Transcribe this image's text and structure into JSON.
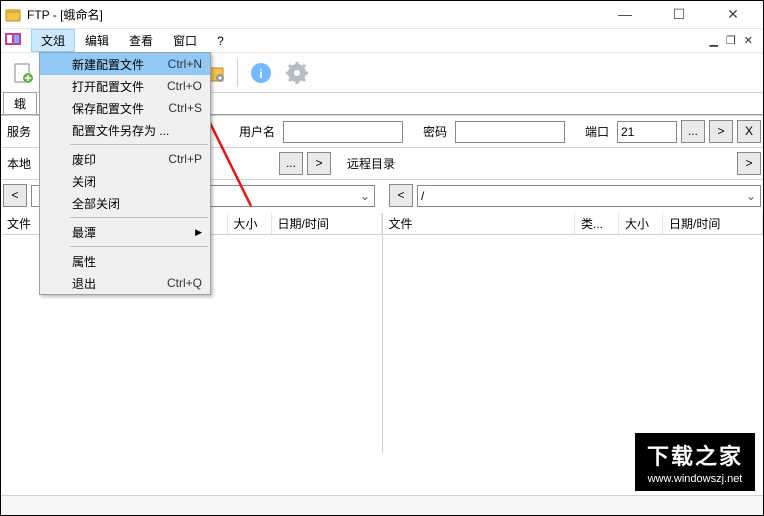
{
  "window": {
    "title": "FTP - [蛾命名]"
  },
  "menubar": {
    "file": "文俎",
    "edit": "编辑",
    "view": "查看",
    "window": "窗口",
    "help": "?"
  },
  "dropdown": {
    "new_profile": {
      "label": "新建配置文件",
      "shortcut": "Ctrl+N"
    },
    "open_profile": {
      "label": "打开配置文件",
      "shortcut": "Ctrl+O"
    },
    "save_profile": {
      "label": "保存配置文件",
      "shortcut": "Ctrl+S"
    },
    "save_as": {
      "label": "配置文件另存为 ..."
    },
    "abort": {
      "label": "废印",
      "shortcut": "Ctrl+P"
    },
    "close": {
      "label": "关闭"
    },
    "close_all": {
      "label": "全部关闭"
    },
    "recent": {
      "label": "最潭"
    },
    "properties": {
      "label": "属性"
    },
    "exit": {
      "label": "退出",
      "shortcut": "Ctrl+Q"
    }
  },
  "tab": {
    "label": "蛾"
  },
  "form": {
    "server_label": "服务",
    "user_label": "用户名",
    "pass_label": "密码",
    "port_label": "端口",
    "port_value": "21",
    "browse": "...",
    "arrow_r": ">",
    "x": "X",
    "local_label": "本地",
    "remote_label": "远程目录",
    "back": "<",
    "remote_path": "/"
  },
  "columns": {
    "file": "文件",
    "type": "类...",
    "size": "大小",
    "datetime": "日期/时间"
  },
  "watermark": {
    "title": "下载之家",
    "url": "www.windowszj.net"
  }
}
